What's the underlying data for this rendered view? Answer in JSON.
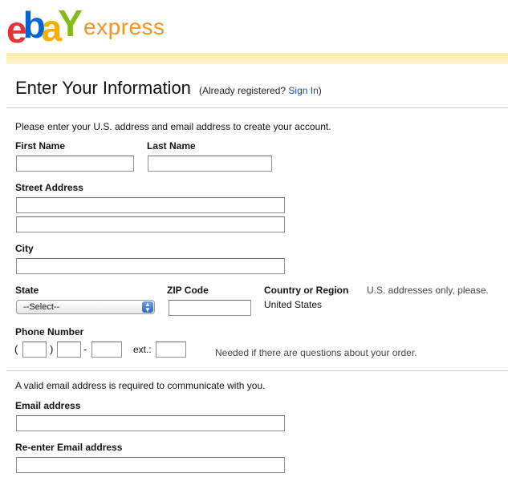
{
  "brand": {
    "logo_letters": [
      "e",
      "b",
      "a",
      "Y"
    ],
    "logo_colors": [
      "#e53238",
      "#0064d2",
      "#f5af02",
      "#86b817"
    ],
    "express": "express",
    "express_color": "#f29324"
  },
  "header": {
    "title": "Enter Your Information",
    "already_registered_prefix": "(Already registered?",
    "sign_in_link": "Sign In",
    "already_registered_suffix": ")"
  },
  "section_address": {
    "intro": "Please enter your U.S. address and email address to create your account.",
    "first_name_label": "First Name",
    "last_name_label": "Last Name",
    "street_label": "Street Address",
    "city_label": "City",
    "state_label": "State",
    "state_selected": "--Select--",
    "zip_label": "ZIP Code",
    "country_label": "Country or Region",
    "country_value": "United States",
    "us_only_note": "U.S. addresses only, please.",
    "phone_label": "Phone Number",
    "phone_open_paren": "(",
    "phone_close_paren": ")",
    "phone_dash": "-",
    "ext_label": "ext.:",
    "phone_note": "Needed if there are questions about your order."
  },
  "section_email": {
    "intro": "A valid email address is required to communicate with you.",
    "email_label": "Email address",
    "reenter_label": "Re-enter Email address"
  },
  "icons": {
    "select_arrow": "updown-arrows-icon"
  }
}
